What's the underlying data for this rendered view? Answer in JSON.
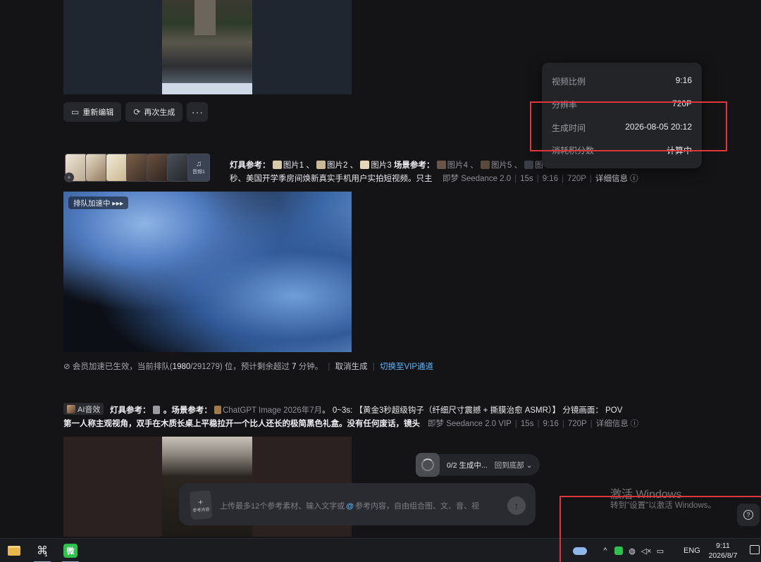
{
  "card1": {
    "buttons": {
      "re_edit": "重新编辑",
      "regenerate": "再次生成",
      "more": "···"
    }
  },
  "card2": {
    "audio_thumb_label": "音频1",
    "badge": "+",
    "prompt_line1": {
      "lamp_label": "灯具参考：",
      "img1": "图片1",
      "sep1": "、",
      "img2": "图片2",
      "sep2": "、",
      "img3": "图片3",
      "scene_label": "场景参考：",
      "img4": "图片4",
      "sep3": "、",
      "img5": "图片5",
      "sep4": "、",
      "img6_trunc": "图"
    },
    "prompt_line2": "秒、美国开学季房间焕新真实手机用户实拍短视频。只主",
    "meta": {
      "model": "即梦 Seedance 2.0",
      "duration": "15s",
      "ratio": "9:16",
      "resolution": "720P",
      "details": "详细信息"
    },
    "queue_tag": "排队加速中 ▸▸▸",
    "queue_status": {
      "prefix": "会员加速已生效，当前排队(",
      "position": "1980",
      "total": "/291279",
      "middle": ") 位，预计剩余超过",
      "minutes": "7",
      "suffix": "分钟。",
      "cancel": "取消生成",
      "vip": "切换至VIP通道"
    }
  },
  "card3": {
    "ai_chip": "AI音效",
    "prompt_line1": {
      "lamp_label": "灯具参考：",
      "scene_label": "。场景参考：",
      "ref": "ChatGPT Image 2026年7月",
      "rest": "。 0~3s: 【黄金3秒超级钩子（纤细尺寸震撼 + 撕膜治愈 ASMR）】 分镜画面： POV"
    },
    "prompt_line2": "第一人称主观视角，双手在木质长桌上平稳拉开一个比人还长的极简黑色礼盒。没有任何废话，镜头",
    "meta": {
      "model": "即梦 Seedance 2.0 VIP",
      "duration": "15s",
      "ratio": "9:16",
      "resolution": "720P",
      "details": "详细信息"
    }
  },
  "popover": {
    "rows": [
      {
        "key": "视频比例",
        "value": "9:16"
      },
      {
        "key": "分辨率",
        "value": "720P"
      },
      {
        "key": "生成时间",
        "value": "2026-08-05 20:12"
      },
      {
        "key": "消耗积分数",
        "value": "计算中"
      }
    ]
  },
  "generating": {
    "status": "0/2 生成中...",
    "back": "回到底部"
  },
  "input": {
    "upload_label": "参考内容",
    "placeholder_a": "上传最多12个参考素材、输入文字或",
    "at": "@",
    "placeholder_b": "参考内容，自由组合图、文、音、视"
  },
  "watermark": {
    "title": "激活 Windows",
    "subtitle": "转到\"设置\"以激活 Windows。"
  },
  "taskbar": {
    "fp_badge": "1",
    "wechat_label": "微",
    "lang": "ENG",
    "time": "9:11",
    "date": "2026/8/7"
  },
  "colors": {
    "accent_blue": "#58b8ff",
    "highlight_red": "#e0353b",
    "wechat_green": "#2dc24f"
  }
}
